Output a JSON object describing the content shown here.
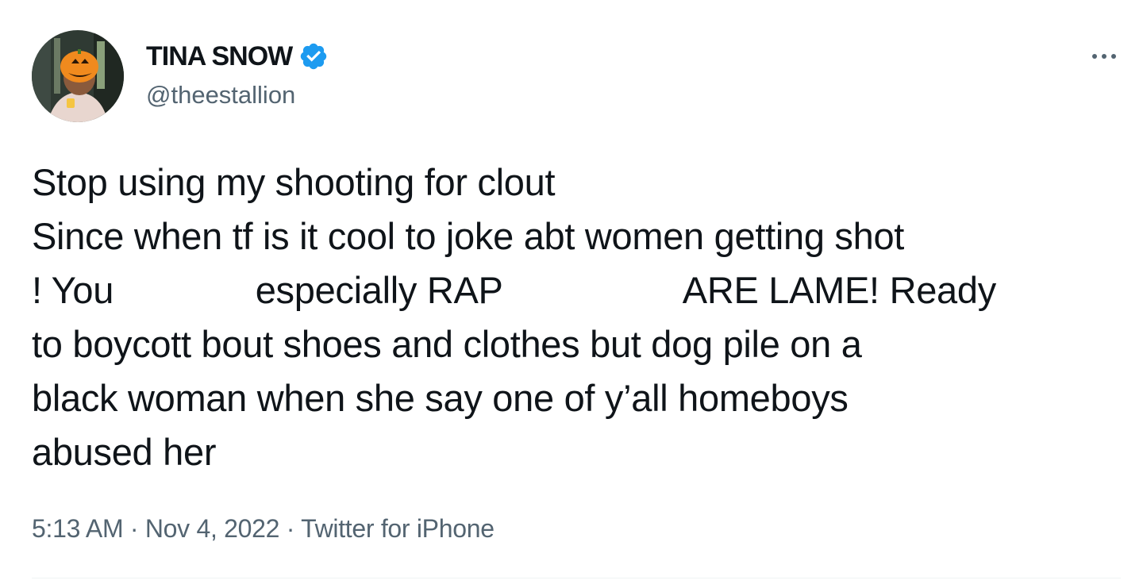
{
  "author": {
    "display_name": "TINA SNOW",
    "handle": "@theestallion",
    "verified": true,
    "verified_icon": "verified-badge-icon",
    "badge_color": "#1d9bf0"
  },
  "tweet": {
    "lines": [
      "Stop using my shooting for clout",
      "Since when tf is it cool to joke abt women getting shot",
      "! You              especially RAP                  ARE LAME! Ready",
      "to boycott bout shoes and clothes but dog pile on a",
      "black woman when she say one of y’all homeboys",
      "abused her"
    ]
  },
  "meta": {
    "time": "5:13 AM",
    "separator": " · ",
    "date": "Nov 4, 2022",
    "source": "Twitter for iPhone"
  },
  "more_icon": "more-options-icon"
}
